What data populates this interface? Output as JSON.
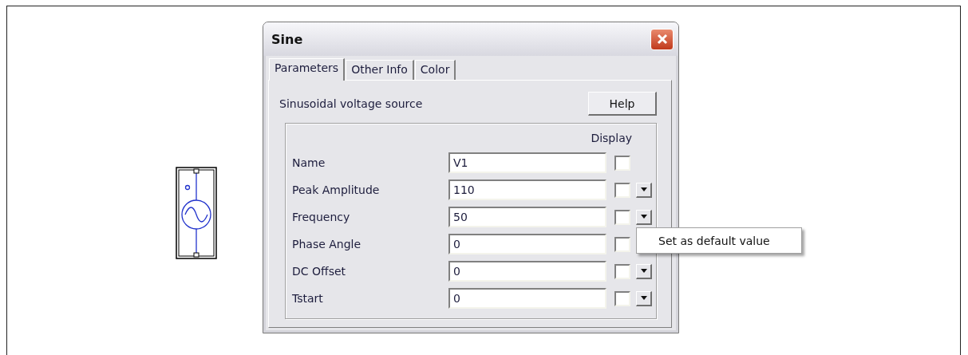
{
  "window": {
    "title": "Sine"
  },
  "tabs": [
    {
      "label": "Parameters",
      "selected": true
    },
    {
      "label": "Other Info",
      "selected": false
    },
    {
      "label": "Color",
      "selected": false
    }
  ],
  "description": "Sinusoidal voltage source",
  "help_button": "Help",
  "display_header": "Display",
  "parameters": [
    {
      "label": "Name",
      "value": "V1",
      "display": false,
      "menu_button": false
    },
    {
      "label": "Peak Amplitude",
      "value": "110",
      "display": false,
      "menu_button": true
    },
    {
      "label": "Frequency",
      "value": "50",
      "display": false,
      "menu_button": true
    },
    {
      "label": "Phase Angle",
      "value": "0",
      "display": false,
      "menu_button": false
    },
    {
      "label": "DC Offset",
      "value": "0",
      "display": false,
      "menu_button": true
    },
    {
      "label": "Tstart",
      "value": "0",
      "display": false,
      "menu_button": true
    }
  ],
  "context_menu": {
    "items": [
      "Set as default value"
    ]
  }
}
